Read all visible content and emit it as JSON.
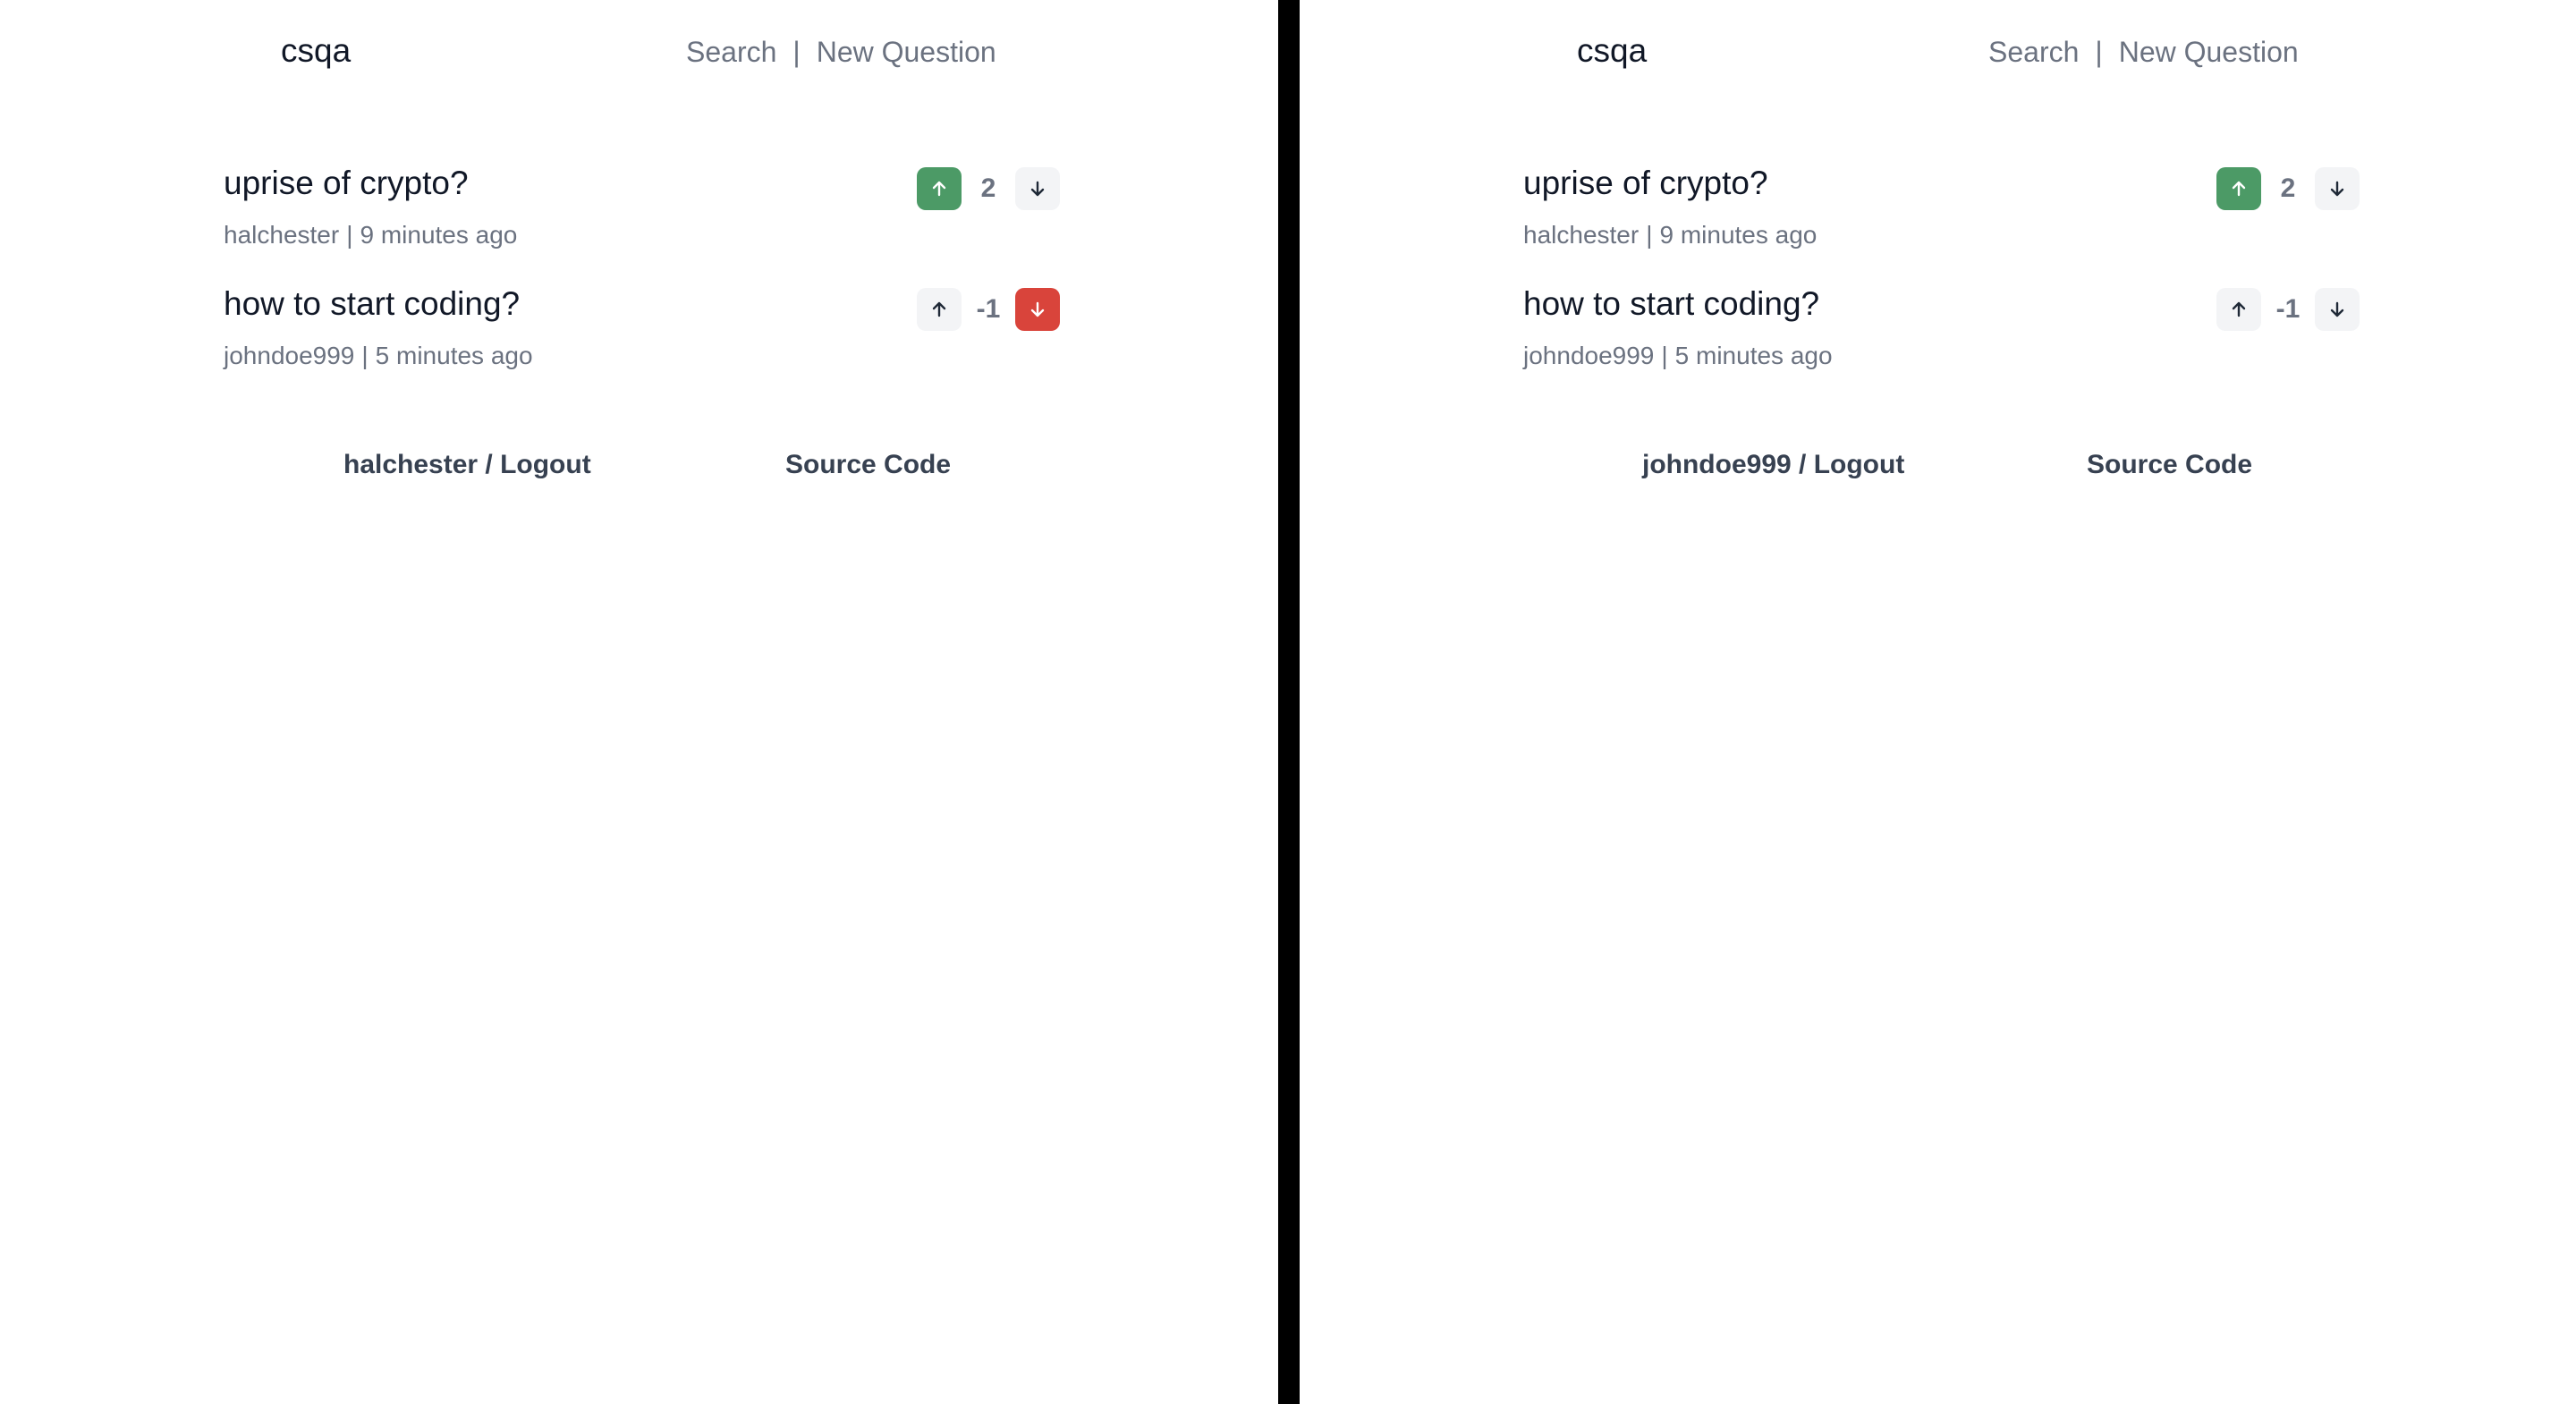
{
  "colors": {
    "upvote_active": "#4c9a66",
    "downvote_active": "#d9443b",
    "vote_idle": "#f3f4f6",
    "divider": "#000000"
  },
  "panes": [
    {
      "brand": "csqa",
      "nav": {
        "search": "Search",
        "separator": "|",
        "new_question": "New Question"
      },
      "questions": [
        {
          "title": "uprise of crypto?",
          "author": "halchester",
          "separator": "|",
          "time": "9 minutes ago",
          "votes": "2",
          "vote_state": "up"
        },
        {
          "title": "how to start coding?",
          "author": "johndoe999",
          "separator": "|",
          "time": "5 minutes ago",
          "votes": "-1",
          "vote_state": "down"
        }
      ],
      "footer": {
        "user_logout": "halchester / Logout",
        "source_code": "Source Code"
      }
    },
    {
      "brand": "csqa",
      "nav": {
        "search": "Search",
        "separator": "|",
        "new_question": "New Question"
      },
      "questions": [
        {
          "title": "uprise of crypto?",
          "author": "halchester",
          "separator": "|",
          "time": "9 minutes ago",
          "votes": "2",
          "vote_state": "up"
        },
        {
          "title": "how to start coding?",
          "author": "johndoe999",
          "separator": "|",
          "time": "5 minutes ago",
          "votes": "-1",
          "vote_state": "none"
        }
      ],
      "footer": {
        "user_logout": "johndoe999 / Logout",
        "source_code": "Source Code"
      }
    }
  ]
}
